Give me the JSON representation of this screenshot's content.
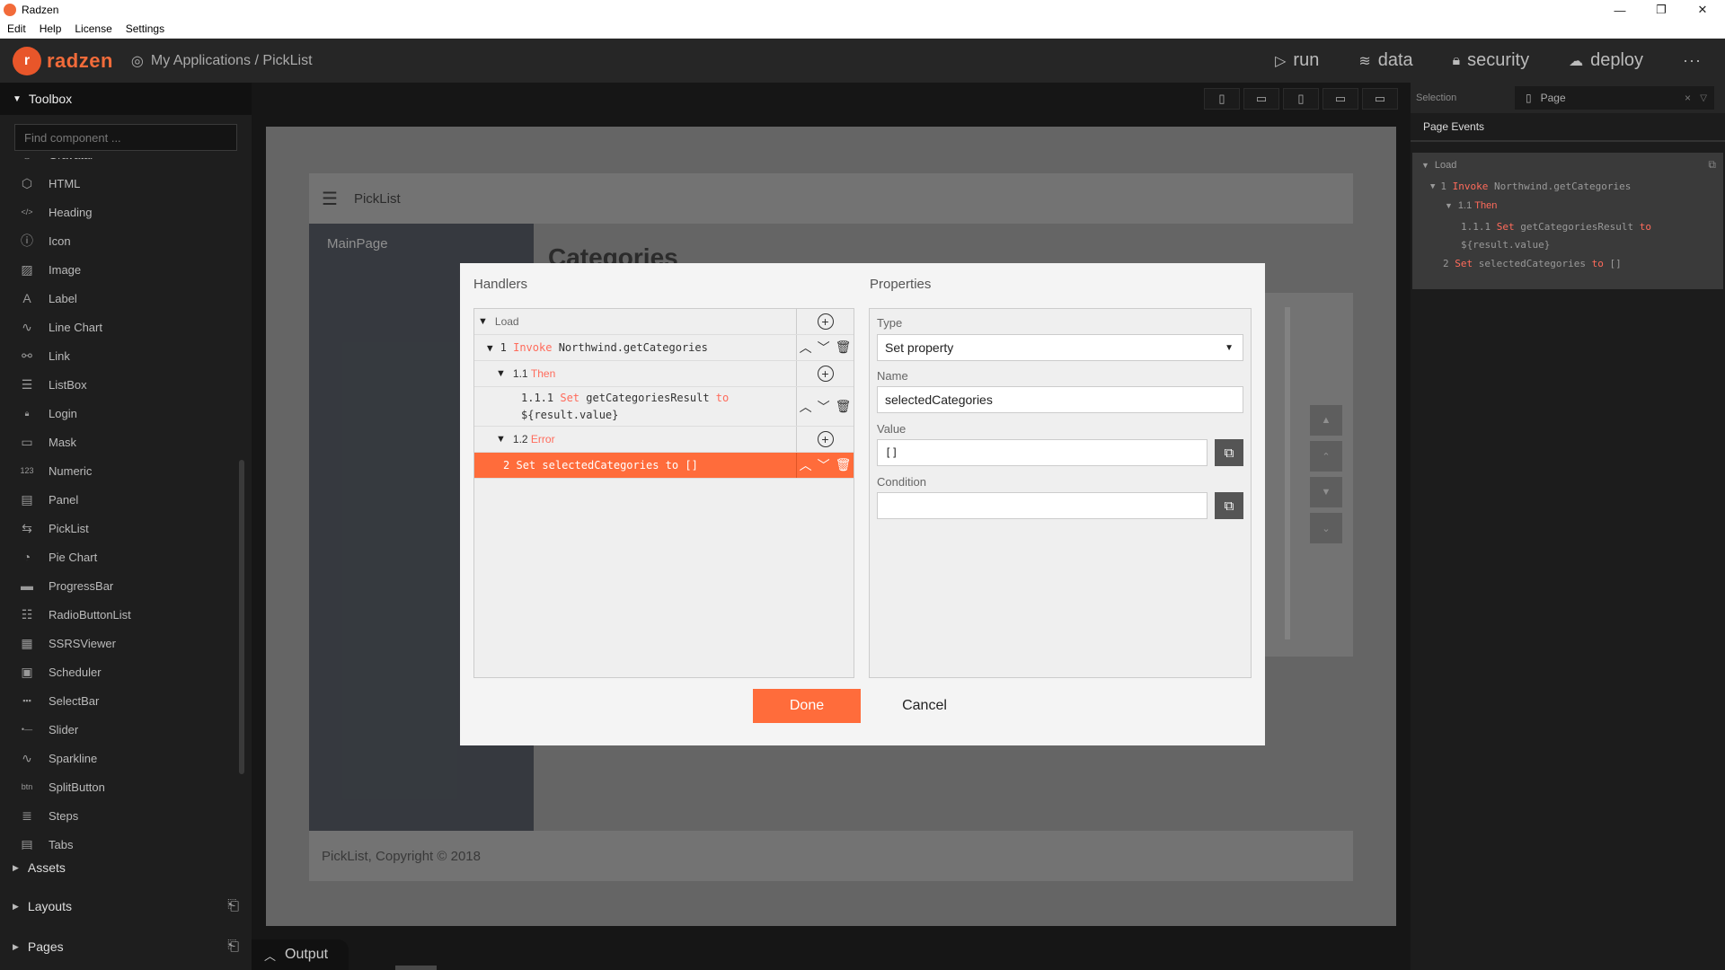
{
  "window": {
    "title": "Radzen",
    "controls": [
      "—",
      "❐",
      "✕"
    ]
  },
  "menu": [
    "Edit",
    "Help",
    "License",
    "Settings"
  ],
  "header": {
    "logo_text": "radzen",
    "breadcrumb": "My Applications / PickList",
    "nav": [
      {
        "label": "run",
        "icon": "play-icon"
      },
      {
        "label": "data",
        "icon": "layers-icon"
      },
      {
        "label": "security",
        "icon": "lock-icon"
      },
      {
        "label": "deploy",
        "icon": "cloud-upload-icon"
      }
    ],
    "more": "···"
  },
  "toolbox": {
    "title": "Toolbox",
    "search_placeholder": "Find component ...",
    "items": [
      {
        "label": "Gravatar",
        "icon": "gravatar-icon"
      },
      {
        "label": "HTML",
        "icon": "html5-icon"
      },
      {
        "label": "Heading",
        "icon": "heading-icon"
      },
      {
        "label": "Icon",
        "icon": "info-icon"
      },
      {
        "label": "Image",
        "icon": "image-icon"
      },
      {
        "label": "Label",
        "icon": "label-icon"
      },
      {
        "label": "Line Chart",
        "icon": "line-chart-icon"
      },
      {
        "label": "Link",
        "icon": "link-icon"
      },
      {
        "label": "ListBox",
        "icon": "listbox-icon"
      },
      {
        "label": "Login",
        "icon": "lock-icon"
      },
      {
        "label": "Mask",
        "icon": "mask-icon"
      },
      {
        "label": "Numeric",
        "icon": "numeric-icon"
      },
      {
        "label": "Panel",
        "icon": "panel-icon"
      },
      {
        "label": "PickList",
        "icon": "picklist-icon"
      },
      {
        "label": "Pie Chart",
        "icon": "pie-chart-icon"
      },
      {
        "label": "ProgressBar",
        "icon": "progressbar-icon"
      },
      {
        "label": "RadioButtonList",
        "icon": "radio-list-icon"
      },
      {
        "label": "SSRSViewer",
        "icon": "report-icon"
      },
      {
        "label": "Scheduler",
        "icon": "calendar-icon"
      },
      {
        "label": "SelectBar",
        "icon": "selectbar-icon"
      },
      {
        "label": "Slider",
        "icon": "slider-icon"
      },
      {
        "label": "Sparkline",
        "icon": "sparkline-icon"
      },
      {
        "label": "SplitButton",
        "icon": "splitbutton-icon"
      },
      {
        "label": "Steps",
        "icon": "steps-icon"
      },
      {
        "label": "Tabs",
        "icon": "tabs-icon"
      }
    ],
    "sections": [
      {
        "label": "Assets"
      },
      {
        "label": "Layouts"
      },
      {
        "label": "Pages"
      }
    ]
  },
  "canvas": {
    "page_title": "PickList",
    "side_item": "MainPage",
    "main_title": "Categories",
    "footer": "PickList, Copyright © 2018",
    "output_tab": "Output"
  },
  "rightpanel": {
    "selection_label": "Selection",
    "selection_value": "Page",
    "tab": "Page Events",
    "tree": {
      "load": "Load",
      "r1_num": "1",
      "r1_kw": "Invoke",
      "r1_val": "Northwind.getCategories",
      "r11_num": "1.1",
      "r11_kw": "Then",
      "r111_num": "1.1.1",
      "r111_kw": "Set",
      "r111_name": "getCategoriesResult",
      "r111_to": "to",
      "r111_val": "${result.value}",
      "r2_num": "2",
      "r2_kw": "Set",
      "r2_name": "selectedCategories",
      "r2_to": "to",
      "r2_val": "[]"
    }
  },
  "dialog": {
    "handlers_title": "Handlers",
    "properties_title": "Properties",
    "handlers": {
      "load": "Load",
      "r1_num": "1",
      "r1_kw": "Invoke",
      "r1_val": "Northwind.getCategories",
      "r11_num": "1.1",
      "r11_kw": "Then",
      "r111_num": "1.1.1",
      "r111_kw": "Set",
      "r111_name": "getCategoriesResult",
      "r111_to": "to",
      "r111_val": "${result.value}",
      "r12_num": "1.2",
      "r12_kw": "Error",
      "r2_num": "2",
      "r2_kw": "Set",
      "r2_name": "selectedCategories",
      "r2_to": "to",
      "r2_val": "[]"
    },
    "properties": {
      "type_label": "Type",
      "type_value": "Set property",
      "name_label": "Name",
      "name_value": "selectedCategories",
      "value_label": "Value",
      "value_value": "[]",
      "condition_label": "Condition",
      "condition_value": ""
    },
    "done": "Done",
    "cancel": "Cancel"
  },
  "colors": {
    "accent": "#ff6c3b",
    "keyword": "#ff6b5b"
  }
}
